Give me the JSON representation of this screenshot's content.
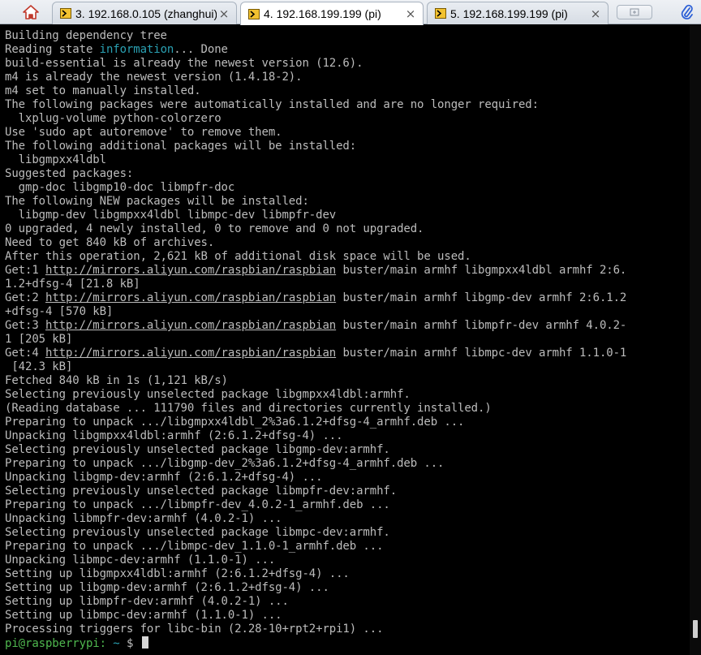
{
  "tabs": [
    {
      "label": "3. 192.168.0.105 (zhanghui)",
      "active": false,
      "icon": "terminal-session-icon"
    },
    {
      "label": "4. 192.168.199.199 (pi)",
      "active": true,
      "icon": "terminal-session-icon"
    },
    {
      "label": "5. 192.168.199.199 (pi)",
      "active": false,
      "icon": "terminal-session-icon"
    }
  ],
  "toolbar": {
    "home_icon": "home-icon",
    "new_tab_icon": "new-tab-icon",
    "attach_icon": "paperclip-icon",
    "close_glyph": "×"
  },
  "colors": {
    "terminal_bg": "#000000",
    "text": "#bcbcbc",
    "highlight_cyan": "#2aa1b3",
    "prompt_green": "#4fb84f"
  },
  "terminal": {
    "lines": [
      [
        {
          "t": "Building dependency tree"
        }
      ],
      [
        {
          "t": "Reading state "
        },
        {
          "t": "information",
          "c": "cyan"
        },
        {
          "t": "... Done"
        }
      ],
      [
        {
          "t": "build-essential is already the newest version (12.6)."
        }
      ],
      [
        {
          "t": "m4 is already the newest version (1.4.18-2)."
        }
      ],
      [
        {
          "t": "m4 set to manually installed."
        }
      ],
      [
        {
          "t": "The following packages were automatically installed and are no longer required:"
        }
      ],
      [
        {
          "t": "  lxplug-volume python-colorzero"
        }
      ],
      [
        {
          "t": "Use 'sudo apt autoremove' to remove them."
        }
      ],
      [
        {
          "t": "The following additional packages will be installed:"
        }
      ],
      [
        {
          "t": "  libgmpxx4ldbl"
        }
      ],
      [
        {
          "t": "Suggested packages:"
        }
      ],
      [
        {
          "t": "  gmp-doc libgmp10-doc libmpfr-doc"
        }
      ],
      [
        {
          "t": "The following NEW packages will be installed:"
        }
      ],
      [
        {
          "t": "  libgmp-dev libgmpxx4ldbl libmpc-dev libmpfr-dev"
        }
      ],
      [
        {
          "t": "0 upgraded, 4 newly installed, 0 to remove and 0 not upgraded."
        }
      ],
      [
        {
          "t": "Need to get 840 kB of archives."
        }
      ],
      [
        {
          "t": "After this operation, 2,621 kB of additional disk space will be used."
        }
      ],
      [
        {
          "t": "Get:1 "
        },
        {
          "t": "http://mirrors.aliyun.com/raspbian/raspbian",
          "c": "link"
        },
        {
          "t": " buster/main armhf libgmpxx4ldbl armhf 2:6."
        }
      ],
      [
        {
          "t": "1.2+dfsg-4 [21.8 kB]"
        }
      ],
      [
        {
          "t": "Get:2 "
        },
        {
          "t": "http://mirrors.aliyun.com/raspbian/raspbian",
          "c": "link"
        },
        {
          "t": " buster/main armhf libgmp-dev armhf 2:6.1.2"
        }
      ],
      [
        {
          "t": "+dfsg-4 [570 kB]"
        }
      ],
      [
        {
          "t": "Get:3 "
        },
        {
          "t": "http://mirrors.aliyun.com/raspbian/raspbian",
          "c": "link"
        },
        {
          "t": " buster/main armhf libmpfr-dev armhf 4.0.2-"
        }
      ],
      [
        {
          "t": "1 [205 kB]"
        }
      ],
      [
        {
          "t": "Get:4 "
        },
        {
          "t": "http://mirrors.aliyun.com/raspbian/raspbian",
          "c": "link"
        },
        {
          "t": " buster/main armhf libmpc-dev armhf 1.1.0-1"
        }
      ],
      [
        {
          "t": " [42.3 kB]"
        }
      ],
      [
        {
          "t": "Fetched 840 kB in 1s (1,121 kB/s)"
        }
      ],
      [
        {
          "t": "Selecting previously unselected package libgmpxx4ldbl:armhf."
        }
      ],
      [
        {
          "t": "(Reading database ... 111790 files and directories currently installed.)"
        }
      ],
      [
        {
          "t": "Preparing to unpack .../libgmpxx4ldbl_2%3a6.1.2+dfsg-4_armhf.deb ..."
        }
      ],
      [
        {
          "t": "Unpacking libgmpxx4ldbl:armhf (2:6.1.2+dfsg-4) ..."
        }
      ],
      [
        {
          "t": "Selecting previously unselected package libgmp-dev:armhf."
        }
      ],
      [
        {
          "t": "Preparing to unpack .../libgmp-dev_2%3a6.1.2+dfsg-4_armhf.deb ..."
        }
      ],
      [
        {
          "t": "Unpacking libgmp-dev:armhf (2:6.1.2+dfsg-4) ..."
        }
      ],
      [
        {
          "t": "Selecting previously unselected package libmpfr-dev:armhf."
        }
      ],
      [
        {
          "t": "Preparing to unpack .../libmpfr-dev_4.0.2-1_armhf.deb ..."
        }
      ],
      [
        {
          "t": "Unpacking libmpfr-dev:armhf (4.0.2-1) ..."
        }
      ],
      [
        {
          "t": "Selecting previously unselected package libmpc-dev:armhf."
        }
      ],
      [
        {
          "t": "Preparing to unpack .../libmpc-dev_1.1.0-1_armhf.deb ..."
        }
      ],
      [
        {
          "t": "Unpacking libmpc-dev:armhf (1.1.0-1) ..."
        }
      ],
      [
        {
          "t": "Setting up libgmpxx4ldbl:armhf (2:6.1.2+dfsg-4) ..."
        }
      ],
      [
        {
          "t": "Setting up libgmp-dev:armhf (2:6.1.2+dfsg-4) ..."
        }
      ],
      [
        {
          "t": "Setting up libmpfr-dev:armhf (4.0.2-1) ..."
        }
      ],
      [
        {
          "t": "Setting up libmpc-dev:armhf (1.1.0-1) ..."
        }
      ],
      [
        {
          "t": "Processing triggers for libc-bin (2.28-10+rpt2+rpi1) ..."
        }
      ]
    ],
    "prompt": {
      "user_host": "pi@raspberrypi:",
      "path": "~",
      "symbol": "$"
    }
  }
}
